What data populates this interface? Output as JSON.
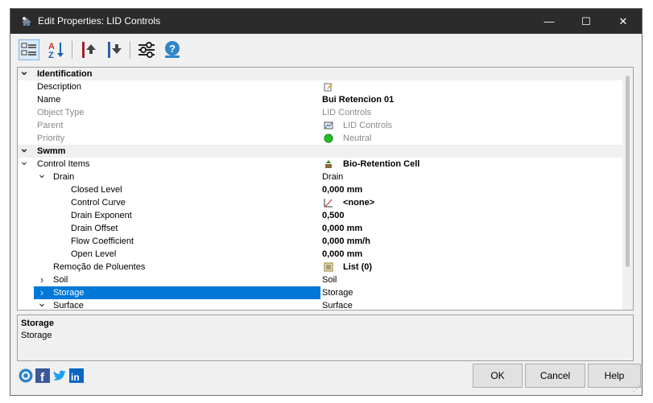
{
  "window": {
    "title": "Edit Properties: LID Controls",
    "minimize": "—",
    "maximize": "☐",
    "close": "✕"
  },
  "toolbar": {
    "buttons": [
      "categorized-view",
      "alphabetical-sort",
      "move-up",
      "move-down",
      "settings",
      "help"
    ]
  },
  "grid": {
    "rows": [
      {
        "type": "cat",
        "expand": "v",
        "name": "Identification",
        "value": ""
      },
      {
        "type": "prop",
        "name": "Description",
        "value": "",
        "icon": "edit-icon"
      },
      {
        "type": "prop",
        "name": "Name",
        "value": "Bui Retencion 01",
        "bold": true
      },
      {
        "type": "prop",
        "name": "Object Type",
        "value": "LID Controls",
        "grey": true
      },
      {
        "type": "prop",
        "name": "Parent",
        "value": "LID Controls",
        "grey": true,
        "icon": "lid-icon"
      },
      {
        "type": "prop",
        "name": "Priority",
        "value": "Neutral",
        "grey": true,
        "icon": "green-dot-icon"
      },
      {
        "type": "cat",
        "expand": "v",
        "name": "Swmm",
        "value": ""
      },
      {
        "type": "prop",
        "name": "Control Items",
        "value": "Bio-Retention Cell",
        "bold": true,
        "expand": "v",
        "icon": "bio-icon"
      },
      {
        "type": "prop",
        "level": 1,
        "name": "Drain",
        "value": "Drain",
        "expand": "v"
      },
      {
        "type": "prop",
        "level": 2,
        "name": "Closed Level",
        "value": "0,000 mm",
        "bold": true
      },
      {
        "type": "prop",
        "level": 2,
        "name": "Control Curve",
        "value": "<none>",
        "bold": true,
        "icon": "curve-icon"
      },
      {
        "type": "prop",
        "level": 2,
        "name": "Drain Exponent",
        "value": "0,500",
        "bold": true
      },
      {
        "type": "prop",
        "level": 2,
        "name": "Drain Offset",
        "value": "0,000 mm",
        "bold": true
      },
      {
        "type": "prop",
        "level": 2,
        "name": "Flow Coefficient",
        "value": "0,000 mm/h",
        "bold": true
      },
      {
        "type": "prop",
        "level": 2,
        "name": "Open Level",
        "value": "0,000 mm",
        "bold": true
      },
      {
        "type": "prop",
        "level": 1,
        "name": "Remoção de Poluentes",
        "value": "List (0)",
        "bold": true,
        "icon": "list-icon"
      },
      {
        "type": "prop",
        "level": 1,
        "name": "Soil",
        "value": "Soil",
        "expand": ">"
      },
      {
        "type": "prop",
        "level": 1,
        "name": "Storage",
        "value": "Storage",
        "expand": ">",
        "selected": true
      },
      {
        "type": "prop",
        "level": 1,
        "name": "Surface",
        "value": "Surface",
        "expand": "v"
      }
    ]
  },
  "description": {
    "title": "Storage",
    "text": "Storage"
  },
  "social": [
    "help-circle-icon",
    "facebook-icon",
    "twitter-icon",
    "linkedin-icon"
  ],
  "buttons": {
    "ok": "OK",
    "cancel": "Cancel",
    "help": "Help"
  },
  "colors": {
    "selection": "#0078d7",
    "titlebar": "#2b2b2b"
  }
}
